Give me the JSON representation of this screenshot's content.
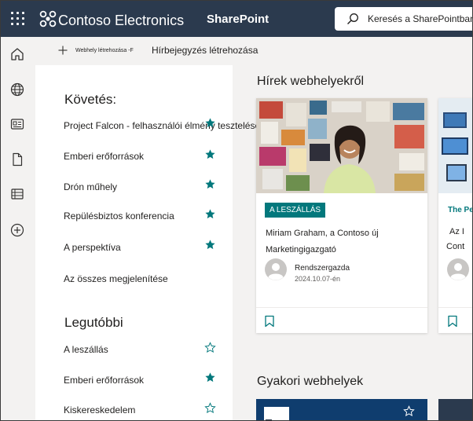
{
  "suite": {
    "brand": "Contoso Electronics",
    "app_name": "SharePoint",
    "search_placeholder": "Keresés a SharePointban"
  },
  "app_bar": {
    "icons": [
      "home-icon",
      "globe-icon",
      "news-icon",
      "document-icon",
      "list-icon",
      "add-icon"
    ]
  },
  "command_bar": {
    "create_site": "Webhely létrehozása -F",
    "create_news": "Hírbejegyzés létrehozása"
  },
  "following": {
    "title": "Követés:",
    "items": [
      {
        "label": "Project Falcon - felhasználói élmény tesztelése",
        "starred": true
      },
      {
        "label": "Emberi erőforrások",
        "starred": true
      },
      {
        "label": "Drón műhely",
        "starred": true
      },
      {
        "label": "Repülésbiztos konferencia",
        "starred": true
      },
      {
        "label": "A perspektíva",
        "starred": true
      }
    ],
    "see_all": "Az összes megjelenítése"
  },
  "recent": {
    "title": "Legutóbbi",
    "items": [
      {
        "label": "A leszállás",
        "starred": false
      },
      {
        "label": "Emberi erőforrások",
        "starred": true
      },
      {
        "label": "Kiskereskedelem",
        "starred": false
      }
    ]
  },
  "news": {
    "title": "Hírek webhelyekről",
    "cards": [
      {
        "badge": "A LESZÁLLÁS",
        "headline_line1": "Miriam Graham, a Contoso új",
        "headline_line2": "Marketingigazgató",
        "author": "Rendszergazda",
        "date": "2024.10.07-én"
      },
      {
        "badge": "The Pe",
        "headline_line1": "Az I",
        "headline_line2": "Cont"
      }
    ]
  },
  "frequent": {
    "title": "Gyakori webhelyek"
  },
  "colors": {
    "suite_bar": "#2b3a4e",
    "accent_teal": "#03787c",
    "star_filled": "#03787c"
  }
}
